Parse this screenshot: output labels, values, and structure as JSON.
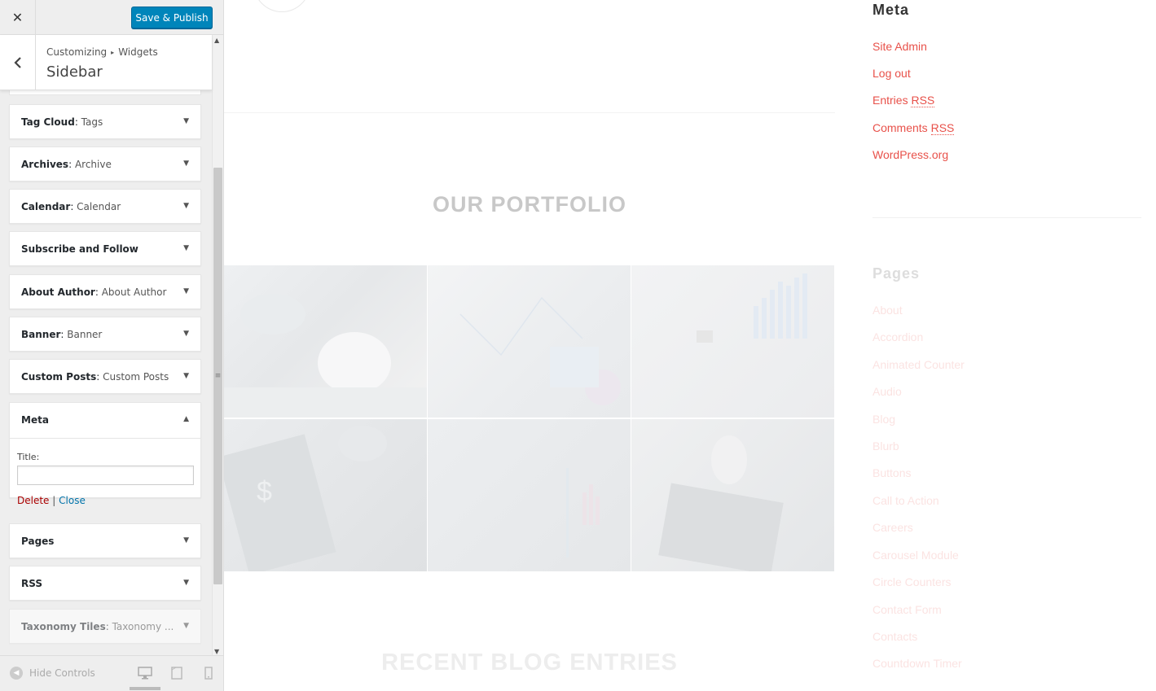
{
  "customizer": {
    "close_label": "✕",
    "save_label": "Save & Publish",
    "breadcrumb": {
      "root": "Customizing",
      "separator": "▸",
      "current": "Widgets"
    },
    "section_title": "Sidebar",
    "widgets": [
      {
        "type": "Tag Cloud",
        "instance": "Tags"
      },
      {
        "type": "Archives",
        "instance": "Archive"
      },
      {
        "type": "Calendar",
        "instance": "Calendar"
      },
      {
        "type": "Subscribe and Follow",
        "instance": ""
      },
      {
        "type": "About Author",
        "instance": "About Author"
      },
      {
        "type": "Banner",
        "instance": "Banner"
      },
      {
        "type": "Custom Posts",
        "instance": "Custom Posts"
      }
    ],
    "expanded_widget": {
      "type": "Meta",
      "title_label": "Title:",
      "title_value": "",
      "delete_label": "Delete",
      "divider": "|",
      "close_label": "Close"
    },
    "widgets_after": [
      {
        "type": "Pages",
        "instance": ""
      },
      {
        "type": "RSS",
        "instance": ""
      },
      {
        "type": "Taxonomy Tiles",
        "instance": "Taxonomy ..."
      }
    ],
    "hide_controls_label": "Hide Controls"
  },
  "preview": {
    "portfolio_heading": "OUR PORTFOLIO",
    "blog_heading": "RECENT BLOG ENTRIES",
    "meta_heading": "Meta",
    "meta_links": [
      "Site Admin",
      "Log out",
      "Entries",
      "Comments",
      "WordPress.org"
    ],
    "rss_abbr": "RSS",
    "pages_heading": "Pages",
    "pages_links": [
      "About",
      "Accordion",
      "Animated Counter",
      "Audio",
      "Blog",
      "Blurb",
      "Buttons",
      "Call to Action",
      "Careers",
      "Carousel Module",
      "Circle Counters",
      "Contact Form",
      "Contacts",
      "Countdown Timer"
    ]
  },
  "colors": {
    "accent": "#0085ba",
    "link": "#e8514a",
    "delete": "#aa0000",
    "close_link": "#0073aa"
  }
}
